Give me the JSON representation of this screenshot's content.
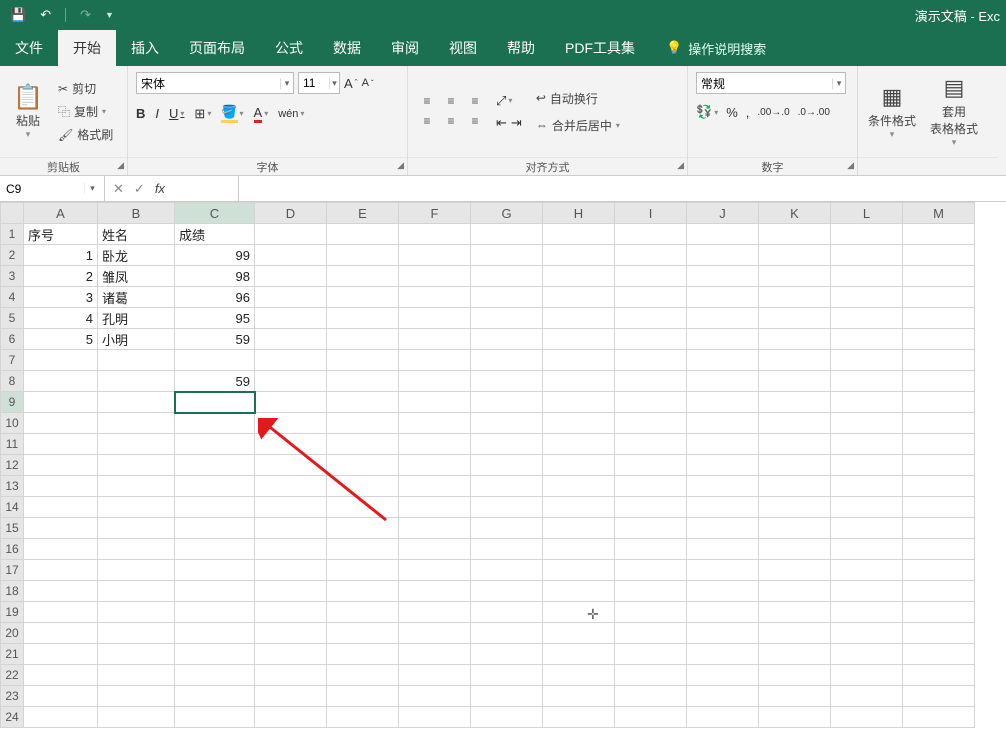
{
  "app": {
    "title": "演示文稿 - Exc"
  },
  "qat": {
    "save": "💾",
    "undo": "↶",
    "redo": "↷"
  },
  "menu": {
    "file": "文件",
    "home": "开始",
    "insert": "插入",
    "layout": "页面布局",
    "formula": "公式",
    "data": "数据",
    "review": "审阅",
    "view": "视图",
    "help": "帮助",
    "pdf": "PDF工具集",
    "tell": "操作说明搜索"
  },
  "ribbon": {
    "clipboard": {
      "label": "剪贴板",
      "paste": "粘贴",
      "cut": "剪切",
      "copy": "复制",
      "painter": "格式刷"
    },
    "font": {
      "label": "字体",
      "name": "宋体",
      "size": "11",
      "bold": "B",
      "italic": "I",
      "underline": "U"
    },
    "align": {
      "label": "对齐方式",
      "wrap": "自动换行",
      "merge": "合并后居中"
    },
    "number": {
      "label": "数字",
      "general": "常规",
      "pct": "%",
      "comma": ",",
      "dec_inc": ".0→.00",
      "dec_dec": ".00→.0"
    },
    "styles": {
      "cond": "条件格式",
      "table": "套用\n表格格式"
    }
  },
  "namebox": "C9",
  "formula": "",
  "columns": [
    "A",
    "B",
    "C",
    "D",
    "E",
    "F",
    "G",
    "H",
    "I",
    "J",
    "K",
    "L",
    "M"
  ],
  "rows": 24,
  "selected": {
    "row": 9,
    "col": "C"
  },
  "sheet": {
    "headers": {
      "A": "序号",
      "B": "姓名",
      "C": "成绩"
    },
    "data": [
      {
        "A": 1,
        "B": "卧龙",
        "C": 99
      },
      {
        "A": 2,
        "B": "雏凤",
        "C": 98
      },
      {
        "A": 3,
        "B": "诸葛",
        "C": 96
      },
      {
        "A": 4,
        "B": "孔明",
        "C": 95
      },
      {
        "A": 5,
        "B": "小明",
        "C": 59
      }
    ],
    "extra": {
      "row": 8,
      "col": "C",
      "value": 59
    }
  },
  "chart_data": {
    "type": "table",
    "title": "",
    "columns": [
      "序号",
      "姓名",
      "成绩"
    ],
    "rows": [
      [
        1,
        "卧龙",
        99
      ],
      [
        2,
        "雏凤",
        98
      ],
      [
        3,
        "诸葛",
        96
      ],
      [
        4,
        "孔明",
        95
      ],
      [
        5,
        "小明",
        59
      ]
    ]
  }
}
